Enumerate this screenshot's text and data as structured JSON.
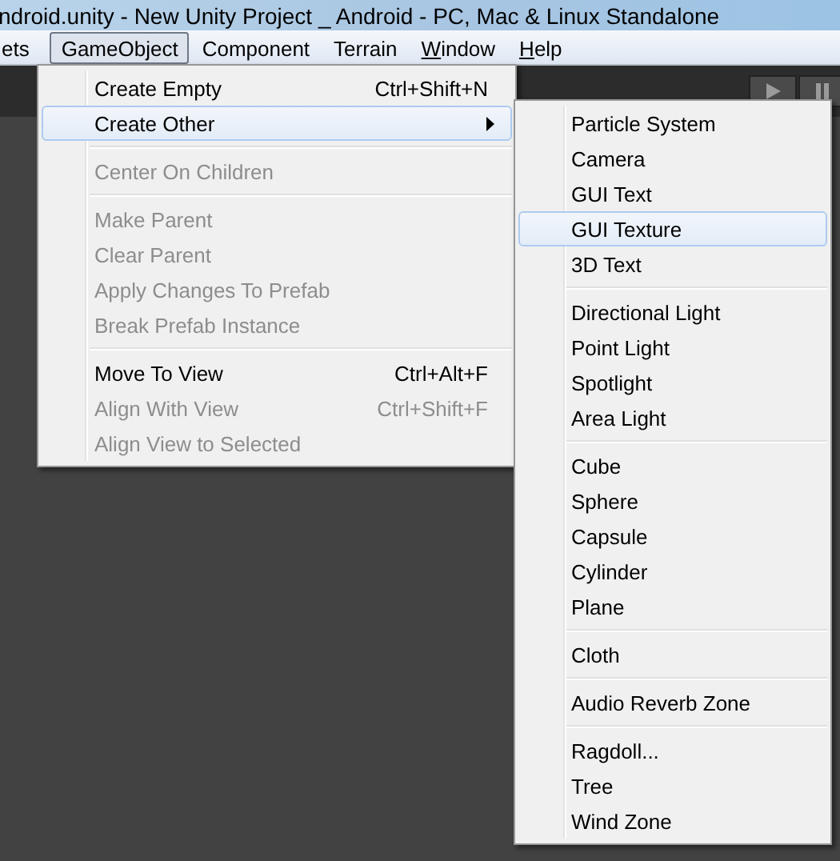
{
  "window": {
    "title": "ndroid.unity - New Unity Project _ Android - PC, Mac & Linux Standalone"
  },
  "menu_bar": [
    {
      "label": "ets",
      "selected": false
    },
    {
      "label": "GameObject",
      "selected": true
    },
    {
      "label": "Component",
      "selected": false
    },
    {
      "label": "Terrain",
      "selected": false
    },
    {
      "access_key": "W",
      "label": "indow",
      "selected": false
    },
    {
      "access_key": "H",
      "label": "elp",
      "selected": false
    }
  ],
  "menu": [
    {
      "kind": "item",
      "label": "Create Empty",
      "shortcut": "Ctrl+Shift+N",
      "disabled": false,
      "selected": false,
      "has_submenu": false
    },
    {
      "kind": "item",
      "label": "Create Other",
      "disabled": false,
      "selected": true,
      "has_submenu": true
    },
    {
      "kind": "separator"
    },
    {
      "kind": "item",
      "label": "Center On Children",
      "disabled": true,
      "selected": false,
      "has_submenu": false
    },
    {
      "kind": "separator"
    },
    {
      "kind": "item",
      "label": "Make Parent",
      "disabled": true,
      "selected": false,
      "has_submenu": false
    },
    {
      "kind": "item",
      "label": "Clear Parent",
      "disabled": true,
      "selected": false,
      "has_submenu": false
    },
    {
      "kind": "item",
      "label": "Apply Changes To Prefab",
      "disabled": true,
      "selected": false,
      "has_submenu": false
    },
    {
      "kind": "item",
      "label": "Break Prefab Instance",
      "disabled": true,
      "selected": false,
      "has_submenu": false
    },
    {
      "kind": "separator"
    },
    {
      "kind": "item",
      "label": "Move To View",
      "shortcut": "Ctrl+Alt+F",
      "disabled": false,
      "selected": false,
      "has_submenu": false
    },
    {
      "kind": "item",
      "label": "Align With View",
      "shortcut": "Ctrl+Shift+F",
      "disabled": true,
      "selected": false,
      "has_submenu": false
    },
    {
      "kind": "item",
      "label": "Align View to Selected",
      "disabled": true,
      "selected": false,
      "has_submenu": false
    }
  ],
  "submenu": [
    {
      "kind": "item",
      "label": "Particle System",
      "selected": false
    },
    {
      "kind": "item",
      "label": "Camera",
      "selected": false
    },
    {
      "kind": "item",
      "label": "GUI Text",
      "selected": false
    },
    {
      "kind": "item",
      "label": "GUI Texture",
      "selected": true
    },
    {
      "kind": "item",
      "label": "3D Text",
      "selected": false
    },
    {
      "kind": "separator"
    },
    {
      "kind": "item",
      "label": "Directional Light",
      "selected": false
    },
    {
      "kind": "item",
      "label": "Point Light",
      "selected": false
    },
    {
      "kind": "item",
      "label": "Spotlight",
      "selected": false
    },
    {
      "kind": "item",
      "label": "Area Light",
      "selected": false
    },
    {
      "kind": "separator"
    },
    {
      "kind": "item",
      "label": "Cube",
      "selected": false
    },
    {
      "kind": "item",
      "label": "Sphere",
      "selected": false
    },
    {
      "kind": "item",
      "label": "Capsule",
      "selected": false
    },
    {
      "kind": "item",
      "label": "Cylinder",
      "selected": false
    },
    {
      "kind": "item",
      "label": "Plane",
      "selected": false
    },
    {
      "kind": "separator"
    },
    {
      "kind": "item",
      "label": "Cloth",
      "selected": false
    },
    {
      "kind": "separator"
    },
    {
      "kind": "item",
      "label": "Audio Reverb Zone",
      "selected": false
    },
    {
      "kind": "separator"
    },
    {
      "kind": "item",
      "label": "Ragdoll...",
      "selected": false
    },
    {
      "kind": "item",
      "label": "Tree",
      "selected": false
    },
    {
      "kind": "item",
      "label": "Wind Zone",
      "selected": false
    }
  ]
}
